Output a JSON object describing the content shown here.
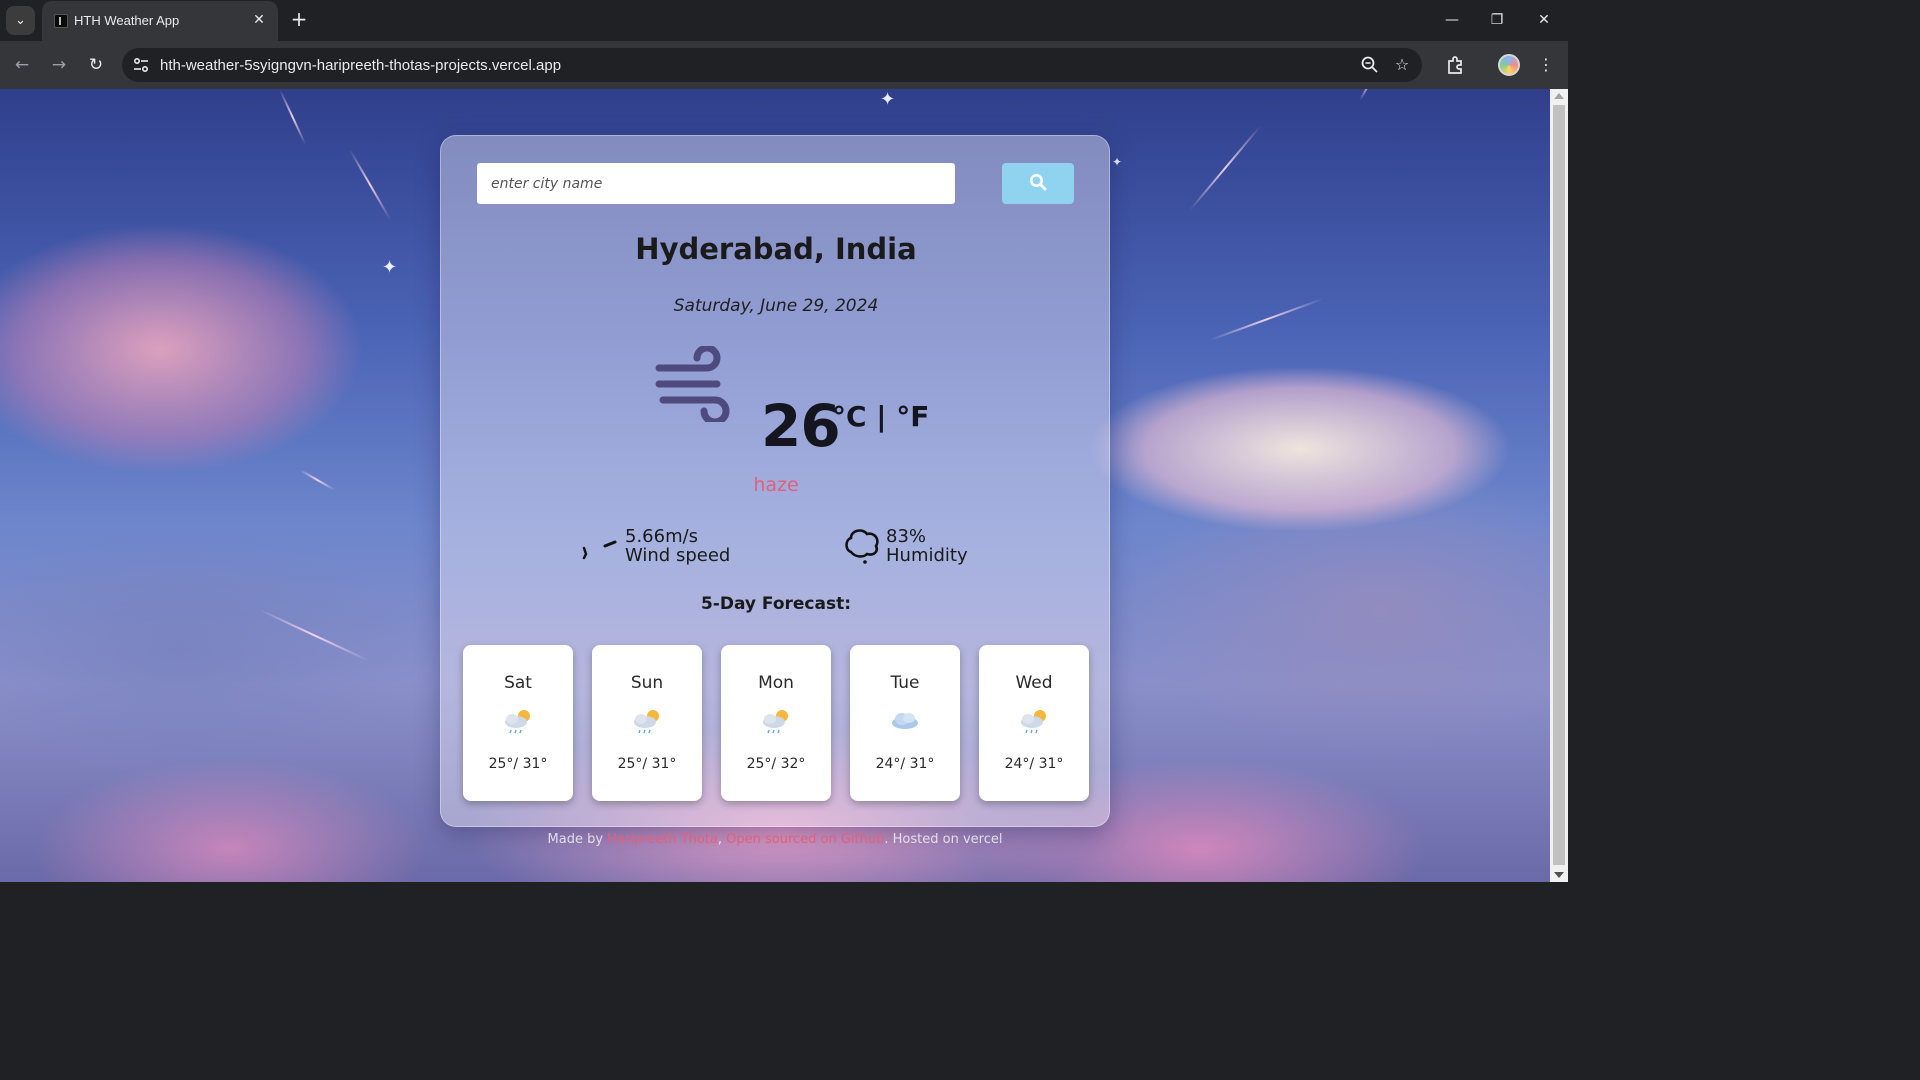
{
  "browser": {
    "tab_title": "HTH Weather App",
    "url": "hth-weather-5syigngvn-haripreeth-thotas-projects.vercel.app"
  },
  "weather": {
    "search_placeholder": "enter city name",
    "city": "Hyderabad, India",
    "date": "Saturday, June 29, 2024",
    "temperature": "26",
    "unit": "°C | °F",
    "condition": "haze",
    "wind_value": "5.66m/s",
    "wind_label": "Wind speed",
    "humidity_value": "83%",
    "humidity_label": "Humidity",
    "forecast_title": "5-Day Forecast:",
    "forecast": [
      {
        "day": "Sat",
        "temps": "25°/ 31°",
        "icon": "light-rain-sun-icon"
      },
      {
        "day": "Sun",
        "temps": "25°/ 31°",
        "icon": "light-rain-sun-icon"
      },
      {
        "day": "Mon",
        "temps": "25°/ 32°",
        "icon": "light-rain-sun-icon"
      },
      {
        "day": "Tue",
        "temps": "24°/ 31°",
        "icon": "cloud-icon"
      },
      {
        "day": "Wed",
        "temps": "24°/ 31°",
        "icon": "light-rain-sun-icon"
      }
    ]
  },
  "footer": {
    "prefix": "Made by ",
    "author": "Haripreeth Thota",
    "sep1": ", ",
    "github": "Open sourced on Github",
    "sep2": ". ",
    "hosted": "Hosted on vercel"
  },
  "colors": {
    "accent": "#e3607c",
    "search_button": "#8fd3f0"
  }
}
